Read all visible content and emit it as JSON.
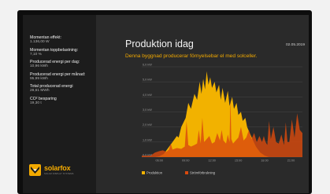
{
  "stats": [
    {
      "label": "Momentan effekt:",
      "value": "1.136,00 W"
    },
    {
      "label": "Momentan toppbelastning:",
      "value": "7,10 %"
    },
    {
      "label": "Producerad energi per dag:",
      "value": "10,96 kWh"
    },
    {
      "label": "Producerad energi per månad:",
      "value": "95,99 kWh"
    },
    {
      "label": "Total producerad energi",
      "value": "28,61 MWh"
    },
    {
      "label": "CO² besparing",
      "value": "19,30 t"
    }
  ],
  "logo": {
    "word": "solarfox",
    "tagline": "SOLAR DISPLAY SYSTEMS"
  },
  "main": {
    "title": "Produktion idag",
    "date": "02.05.2019",
    "subtitle": "Denna byggnad producerar förnyelsebar el med solceller."
  },
  "legend": [
    {
      "label": "Produktion",
      "color": "#f2b200"
    },
    {
      "label": "Strömförbrukning",
      "color": "#d94a0e"
    }
  ],
  "colors": {
    "production": "#f2b200",
    "consumption": "#d94a0e",
    "accent": "#f2a900"
  },
  "chart_data": {
    "type": "area",
    "yticks": [
      "0,0 kW",
      "1,0 kW",
      "2,0 kW",
      "3,0 kW",
      "4,0 kW",
      "5,0 kW",
      "6,0 kW"
    ],
    "xticks": [
      "06:00",
      "09:00",
      "12:00",
      "15:00",
      "18:00",
      "21:00"
    ],
    "ylim": [
      0,
      6
    ],
    "xlim": [
      4.0,
      22.3
    ],
    "series": [
      {
        "name": "Produktion",
        "x": [
          4.0,
          5.5,
          6.0,
          6.5,
          7.0,
          7.5,
          8.0,
          8.2,
          8.5,
          9.0,
          9.3,
          9.6,
          10.0,
          10.3,
          10.6,
          10.8,
          11.0,
          11.2,
          11.4,
          11.6,
          11.8,
          12.0,
          12.3,
          12.5,
          12.8,
          13.0,
          13.2,
          13.5,
          13.8,
          14.0,
          14.3,
          14.5,
          14.8,
          15.0,
          15.3,
          15.5,
          15.8,
          16.0,
          16.3,
          16.6,
          17.0,
          17.5,
          18.0,
          18.5,
          22.3
        ],
        "values": [
          0,
          0,
          0.05,
          0.2,
          0.6,
          1.0,
          1.4,
          1.3,
          2.0,
          2.6,
          3.6,
          3.2,
          4.2,
          3.8,
          5.0,
          4.2,
          5.2,
          4.5,
          5.7,
          4.8,
          5.3,
          4.6,
          5.0,
          4.3,
          4.8,
          3.8,
          4.6,
          3.6,
          4.4,
          3.4,
          4.0,
          3.2,
          3.6,
          2.8,
          3.0,
          2.4,
          2.6,
          2.0,
          1.6,
          1.2,
          0.7,
          0.3,
          0.1,
          0,
          0
        ]
      },
      {
        "name": "Strömförbrukning",
        "x": [
          4.0,
          5.0,
          5.5,
          6.0,
          6.4,
          6.8,
          7.1,
          7.3,
          7.5,
          8.0,
          8.5,
          8.9,
          9.1,
          9.3,
          9.6,
          10.0,
          10.3,
          10.5,
          10.7,
          10.9,
          11.1,
          11.4,
          11.7,
          12.0,
          12.3,
          12.6,
          12.9,
          13.1,
          13.3,
          13.6,
          13.8,
          14.0,
          14.1,
          14.2,
          14.4,
          14.7,
          15.0,
          15.3,
          15.6,
          15.9,
          16.2,
          16.5,
          16.8,
          17.1,
          17.4,
          17.7,
          17.9,
          18.1,
          18.3,
          18.5,
          18.7,
          19.0,
          19.3,
          19.6,
          19.9,
          20.2,
          20.4,
          20.6,
          20.8,
          21.1,
          21.4,
          21.7,
          22.0,
          22.3
        ],
        "values": [
          0.1,
          0.1,
          0.3,
          0.4,
          0.45,
          0.35,
          0.5,
          0.9,
          0.5,
          0.6,
          0.55,
          0.7,
          2.4,
          0.8,
          0.7,
          0.8,
          0.9,
          1.8,
          0.9,
          2.6,
          1.0,
          1.2,
          1.4,
          0.9,
          1.0,
          1.6,
          1.1,
          1.8,
          1.1,
          0.9,
          1.5,
          1.0,
          3.9,
          1.2,
          0.9,
          1.1,
          1.3,
          2.0,
          1.1,
          1.3,
          1.8,
          1.2,
          1.6,
          1.0,
          1.4,
          1.0,
          1.4,
          1.0,
          0.8,
          2.4,
          1.2,
          2.0,
          1.0,
          0.9,
          1.5,
          0.8,
          2.3,
          1.0,
          1.0,
          2.5,
          1.3,
          2.9,
          1.8,
          1.6
        ]
      }
    ]
  }
}
